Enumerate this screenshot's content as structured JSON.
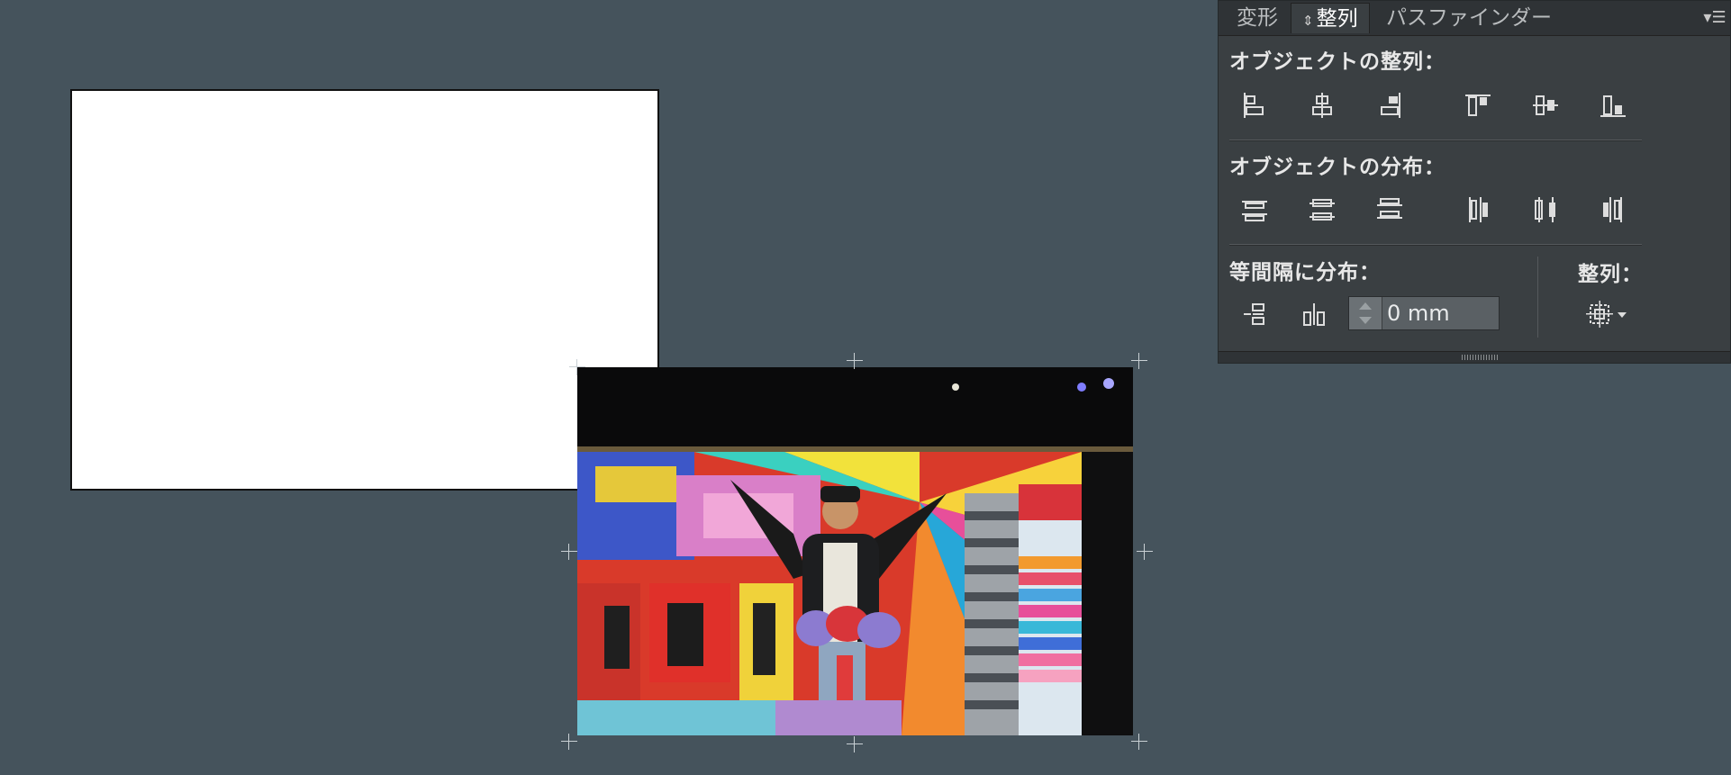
{
  "panel": {
    "tabs": [
      {
        "label": "変形",
        "active": false
      },
      {
        "label": "整列",
        "active": true
      },
      {
        "label": "パスファインダー",
        "active": false
      }
    ],
    "menu_icon": "panel-menu-icon",
    "sections": {
      "align_objects": {
        "title": "オブジェクトの整列：",
        "buttons": [
          "horizontal-align-left",
          "horizontal-align-center",
          "horizontal-align-right",
          "vertical-align-top",
          "vertical-align-center",
          "vertical-align-bottom"
        ]
      },
      "distribute_objects": {
        "title": "オブジェクトの分布：",
        "buttons": [
          "vertical-distribute-top",
          "vertical-distribute-center",
          "vertical-distribute-bottom",
          "horizontal-distribute-left",
          "horizontal-distribute-center",
          "horizontal-distribute-right"
        ]
      },
      "distribute_spacing": {
        "title": "等間隔に分布：",
        "buttons": [
          "vertical-distribute-space",
          "horizontal-distribute-space"
        ],
        "spacing_value": "0 mm"
      },
      "align_to": {
        "title": "整列："
      }
    }
  },
  "colors": {
    "canvas": "#45535c",
    "panel": "#3a3f42",
    "artboard": "#ffffff"
  }
}
